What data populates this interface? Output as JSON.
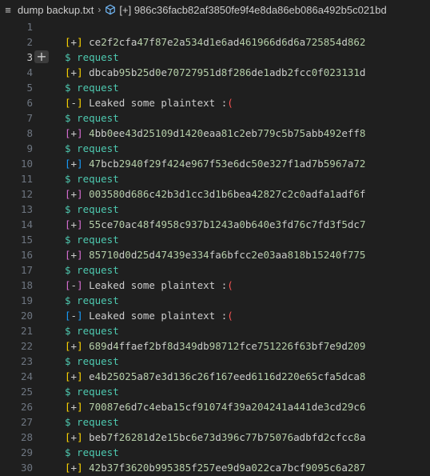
{
  "breadcrumb": {
    "file_icon": "≡",
    "file_name": "dump backup.txt",
    "separator": "›",
    "symbol_icon": "symbol-icon",
    "symbol_name": "[+] 986c36facb82af3850fe9f4e8da86eb086a492b5c021bd"
  },
  "add_button_glyph": "+",
  "active_line": 3,
  "lines": [
    {
      "num": "1",
      "type": "empty"
    },
    {
      "num": "2",
      "type": "hash",
      "bracket": "y",
      "sign": "+",
      "text": "ce2f2cfa47f87e2a534d1e6ad461966d6d6a725854d862"
    },
    {
      "num": "3",
      "type": "request",
      "text": "$ request"
    },
    {
      "num": "4",
      "type": "hash",
      "bracket": "y",
      "sign": "+",
      "text": "dbcab95b25d0e70727951d8f286de1adb2fcc0f023131d"
    },
    {
      "num": "5",
      "type": "request",
      "text": "$ request"
    },
    {
      "num": "6",
      "type": "leak",
      "bracket": "y",
      "sign": "-",
      "text": "Leaked some plaintext :("
    },
    {
      "num": "7",
      "type": "request",
      "text": "$ request"
    },
    {
      "num": "8",
      "type": "hash",
      "bracket": "p",
      "sign": "+",
      "text": "4bb0ee43d25109d1420eaa81c2eb779c5b75abb492eff8"
    },
    {
      "num": "9",
      "type": "request",
      "text": "$ request"
    },
    {
      "num": "10",
      "type": "hash",
      "bracket": "b",
      "sign": "+",
      "text": "47bcb2940f29f424e967f53e6dc50e327f1ad7b5967a72"
    },
    {
      "num": "11",
      "type": "request",
      "text": "$ request"
    },
    {
      "num": "12",
      "type": "hash",
      "bracket": "p",
      "sign": "+",
      "text": "003580d686c42b3d1cc3d1b6bea42827c2c0adfa1adf6f"
    },
    {
      "num": "13",
      "type": "request",
      "text": "$ request"
    },
    {
      "num": "14",
      "type": "hash",
      "bracket": "p",
      "sign": "+",
      "text": "55ce70ac48f4958c937b1243a0b640e3fd76c7fd3f5dc7"
    },
    {
      "num": "15",
      "type": "request",
      "text": "$ request"
    },
    {
      "num": "16",
      "type": "hash",
      "bracket": "p",
      "sign": "+",
      "text": "85710d0d25d47439e334fa6bfcc2e03aa818b15240f775"
    },
    {
      "num": "17",
      "type": "request",
      "text": "$ request"
    },
    {
      "num": "18",
      "type": "leak",
      "bracket": "p",
      "sign": "-",
      "text": "Leaked some plaintext :("
    },
    {
      "num": "19",
      "type": "request",
      "text": "$ request"
    },
    {
      "num": "20",
      "type": "leak",
      "bracket": "b",
      "sign": "-",
      "text": "Leaked some plaintext :("
    },
    {
      "num": "21",
      "type": "request",
      "text": "$ request"
    },
    {
      "num": "22",
      "type": "hash",
      "bracket": "y",
      "sign": "+",
      "text": "689d4ffaef2bf8d349db98712fce751226f63bf7e9d209"
    },
    {
      "num": "23",
      "type": "request",
      "text": "$ request"
    },
    {
      "num": "24",
      "type": "hash",
      "bracket": "y",
      "sign": "+",
      "text": "e4b25025a87e3d136c26f167eed6116d220e65cfa5dca8"
    },
    {
      "num": "25",
      "type": "request",
      "text": "$ request"
    },
    {
      "num": "26",
      "type": "hash",
      "bracket": "y",
      "sign": "+",
      "text": "70087e6d7c4eba15cf91074f39a204241a441de3cd29c6"
    },
    {
      "num": "27",
      "type": "request",
      "text": "$ request"
    },
    {
      "num": "28",
      "type": "hash",
      "bracket": "y",
      "sign": "+",
      "text": "beb7f26281d2e15bc6e73d396c77b75076adbfd2cfcc8a"
    },
    {
      "num": "29",
      "type": "request",
      "text": "$ request"
    },
    {
      "num": "30",
      "type": "hash",
      "bracket": "y",
      "sign": "+",
      "text": "42b37f3620b995385f257ee9d9a022ca7bcf9095c6a287"
    }
  ],
  "colors": {
    "background": "#1f1f1f",
    "line_number": "#6e7681",
    "line_number_active": "#cccccc",
    "text": "#cccccc",
    "number": "#b5cea8",
    "request": "#4ec9b0",
    "bracket_yellow": "#ffd700",
    "bracket_purple": "#da70d6",
    "bracket_blue": "#179fff",
    "sad_paren": "#ff5555"
  }
}
